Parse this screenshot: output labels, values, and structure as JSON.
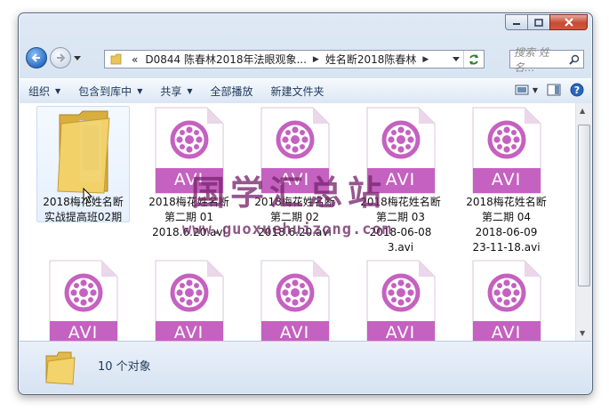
{
  "address": {
    "overflow": "«",
    "crumbs": [
      "D0844 陈春林2018年法眼观象...",
      "姓名断2018陈春林"
    ]
  },
  "search": {
    "placeholder": "搜索 姓名..."
  },
  "toolbar": {
    "organize": "组织",
    "include_in_library": "包含到库中",
    "share": "共享",
    "play_all": "全部播放",
    "new_folder": "新建文件夹"
  },
  "files": [
    {
      "type": "folder",
      "lines": [
        "2018梅花姓名断",
        "实战提高班02期"
      ]
    },
    {
      "type": "avi",
      "badge": "AVI",
      "lines": [
        "2018梅花姓名断",
        "第二期 01",
        "2018.6.20.avi"
      ]
    },
    {
      "type": "avi",
      "badge": "AVI",
      "lines": [
        "2018梅花姓名断",
        "第二期 02",
        "2018.6.20.avi"
      ]
    },
    {
      "type": "avi",
      "badge": "AVI",
      "lines": [
        "2018梅花姓名断",
        "第二期 03",
        "2018-06-08",
        "3.avi"
      ]
    },
    {
      "type": "avi",
      "badge": "AVI",
      "lines": [
        "2018梅花姓名断",
        "第二期 04",
        "2018-06-09",
        "23-11-18.avi"
      ]
    },
    {
      "type": "avi",
      "badge": "AVI",
      "lines": []
    },
    {
      "type": "avi",
      "badge": "AVI",
      "lines": []
    },
    {
      "type": "avi",
      "badge": "AVI",
      "lines": []
    },
    {
      "type": "avi",
      "badge": "AVI",
      "lines": []
    },
    {
      "type": "avi",
      "badge": "AVI",
      "lines": []
    }
  ],
  "status": {
    "count": "10 个对象"
  },
  "watermark": {
    "title": "国学汇总站",
    "url": "www.guoxuehuizong.com"
  },
  "colors": {
    "avi_accent": "#c561c0",
    "folder": "#f3d36b",
    "accent": "#1e395b"
  }
}
